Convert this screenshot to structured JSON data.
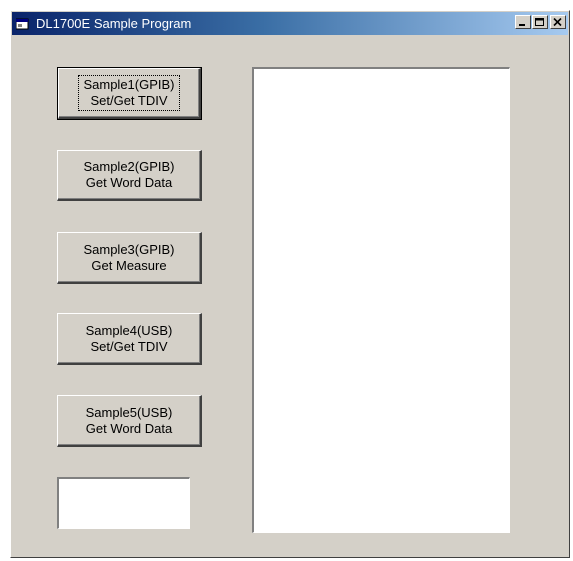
{
  "window": {
    "title": "DL1700E Sample Program",
    "app_icon": "vb-form-icon",
    "controls": {
      "minimize_icon": "minimize-icon",
      "maximize_icon": "maximize-icon",
      "close_icon": "close-icon"
    }
  },
  "buttons": [
    {
      "line1": "Sample1(GPIB)",
      "line2": "Set/Get TDIV"
    },
    {
      "line1": "Sample2(GPIB)",
      "line2": "Get Word Data"
    },
    {
      "line1": "Sample3(GPIB)",
      "line2": "Get Measure"
    },
    {
      "line1": "Sample4(USB)",
      "line2": "Set/Get TDIV"
    },
    {
      "line1": "Sample5(USB)",
      "line2": "Get Word Data"
    }
  ],
  "status_box": {
    "value": ""
  },
  "output_box": {
    "value": ""
  },
  "colors": {
    "face": "#d4d0c8",
    "title_start": "#0a246a",
    "title_end": "#a6caf0"
  }
}
